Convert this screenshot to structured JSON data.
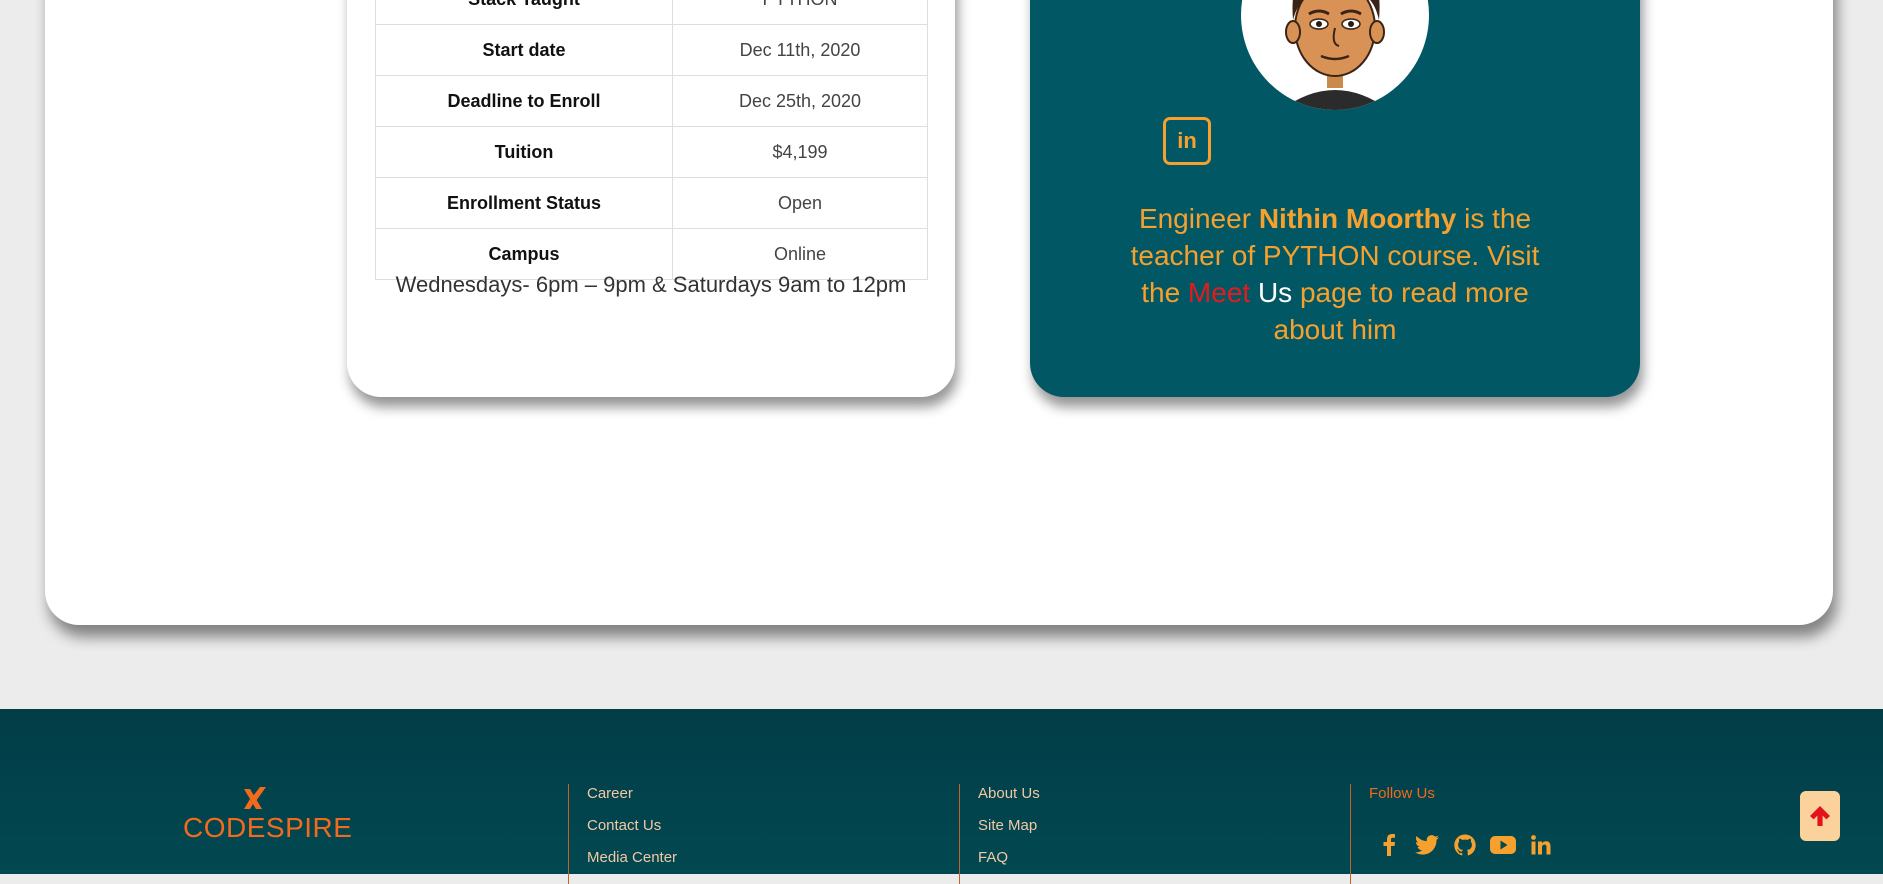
{
  "course": {
    "rows": [
      {
        "label": "Stack Taught",
        "value": "PYTHON"
      },
      {
        "label": "Start date",
        "value": "Dec 11th, 2020"
      },
      {
        "label": "Deadline to Enroll",
        "value": "Dec 25th, 2020"
      },
      {
        "label": "Tuition",
        "value": "$4,199"
      },
      {
        "label": "Enrollment Status",
        "value": "Open"
      },
      {
        "label": "Campus",
        "value": "Online"
      }
    ],
    "schedule": "Wednesdays- 6pm – 9pm & Saturdays 9am to 12pm"
  },
  "teacher": {
    "linkedin_label": "in",
    "bio_prefix": "Engineer ",
    "name": "Nithin Moorthy",
    "bio_mid": " is the teacher of PYTHON course. Visit the ",
    "meet": "Meet",
    "us": " Us",
    "bio_suffix": " page to read more about him"
  },
  "footer": {
    "brand": "CODESPIRE",
    "col1": [
      "Career",
      "Contact Us",
      "Media Center"
    ],
    "col2": [
      "About Us",
      "Site Map",
      "FAQ"
    ],
    "follow_title": "Follow Us",
    "social_icons": [
      "facebook-icon",
      "twitter-icon",
      "github-icon",
      "youtube-icon",
      "linkedin-icon"
    ]
  },
  "colors": {
    "teal": "#025765",
    "orange": "#f6a02e",
    "brand_orange": "#f26a1b",
    "meet_red": "#e21c1c"
  }
}
